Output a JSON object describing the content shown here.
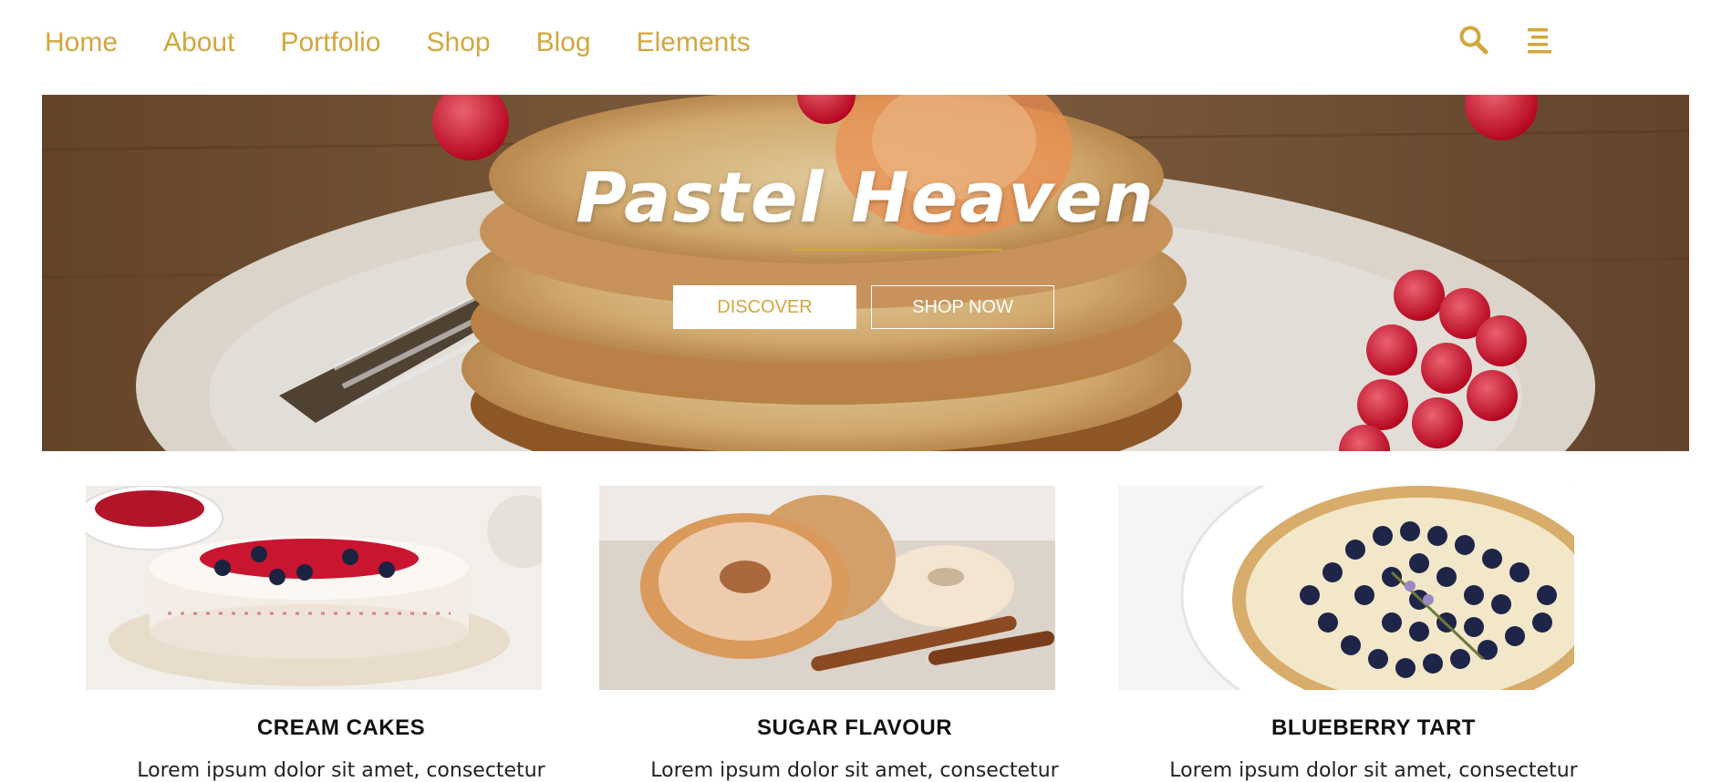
{
  "nav": {
    "links": [
      "Home",
      "About",
      "Portfolio",
      "Shop",
      "Blog",
      "Elements"
    ],
    "icons": [
      "search-icon",
      "menu-icon"
    ],
    "accent_color": "#d2a73e"
  },
  "hero": {
    "title": "Pastel Heaven",
    "buttons": {
      "discover": "DISCOVER",
      "shop_now": "SHOP NOW"
    }
  },
  "cards": [
    {
      "title": "CREAM CAKES",
      "text": "Lorem ipsum dolor sit amet, consectetur"
    },
    {
      "title": "SUGAR FLAVOUR",
      "text": "Lorem ipsum dolor sit amet, consectetur"
    },
    {
      "title": "BLUEBERRY TART",
      "text": "Lorem ipsum dolor sit amet, consectetur"
    }
  ]
}
